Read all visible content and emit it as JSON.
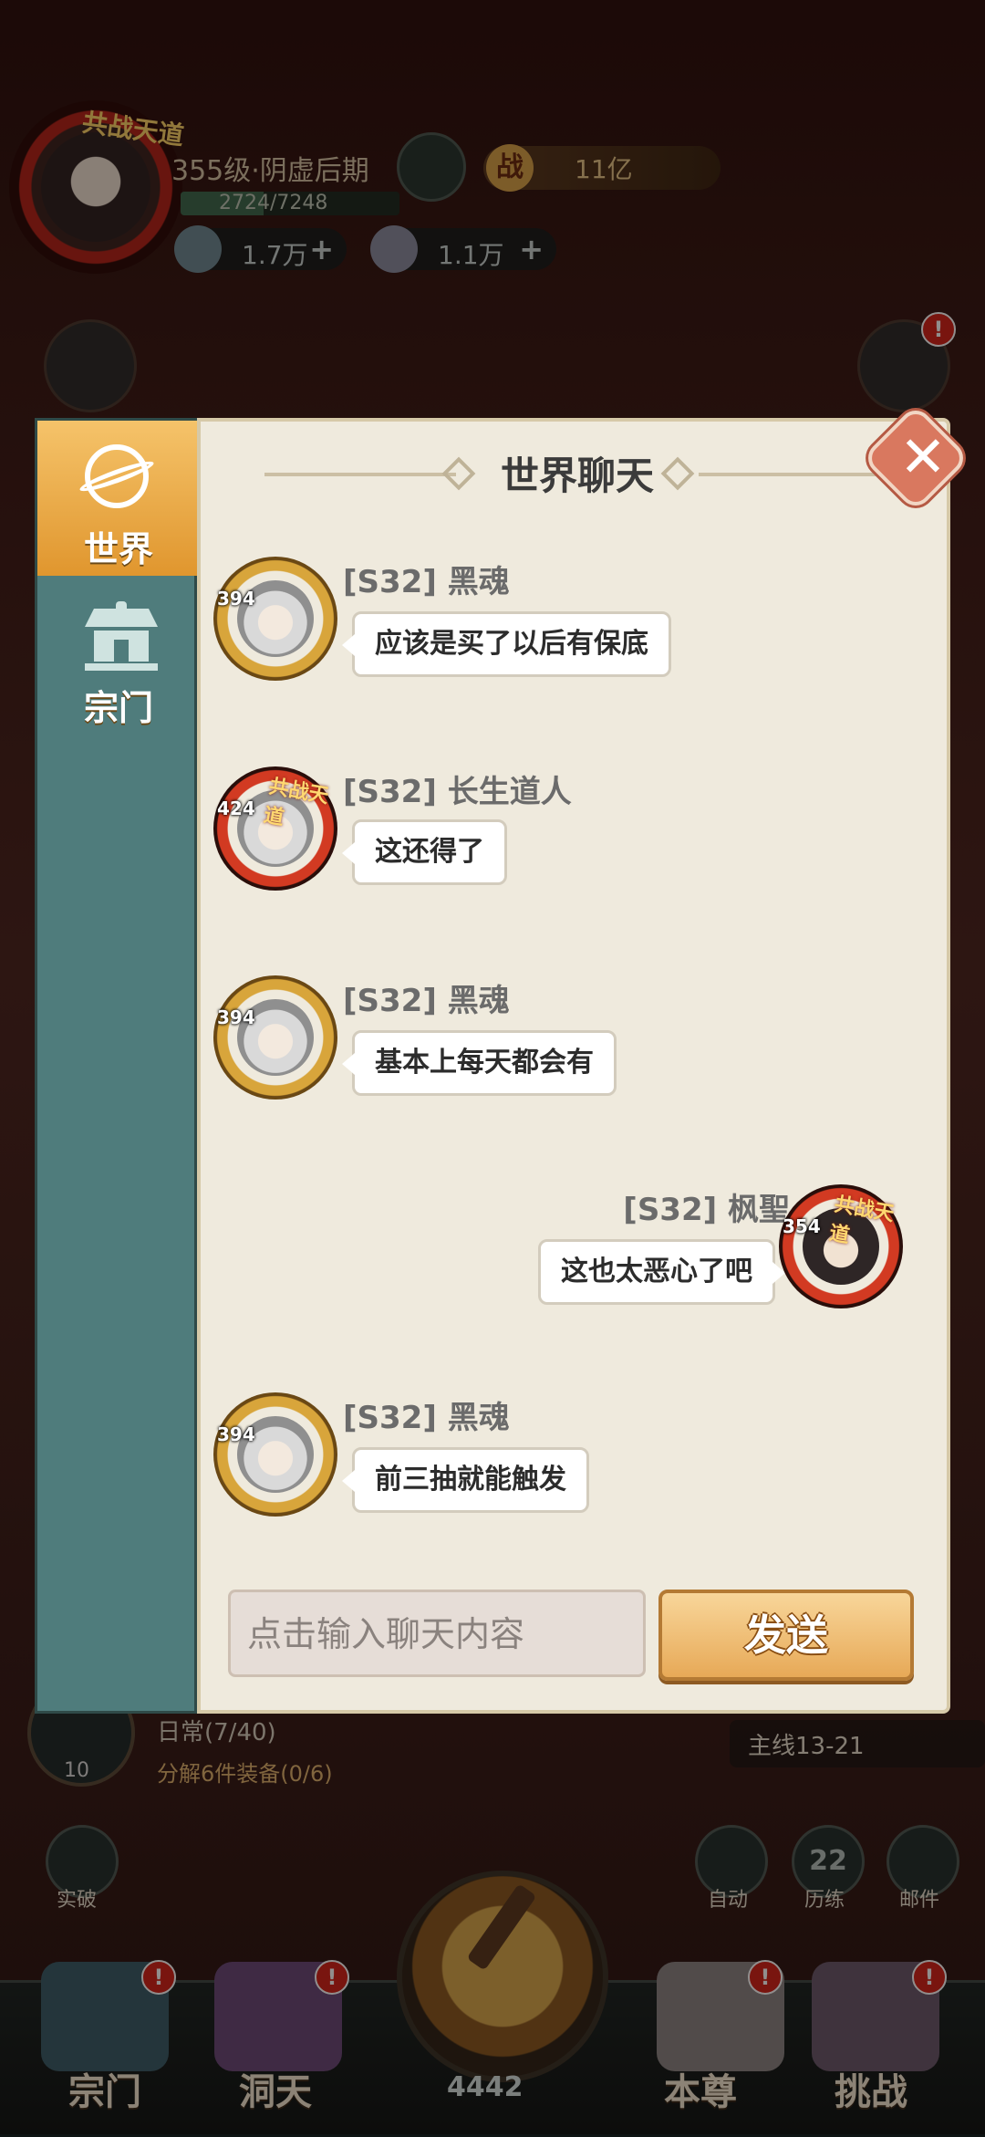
{
  "hud": {
    "level_label": "355级·阴虚后期",
    "exp_text": "2724/7248",
    "exp_fraction": 0.376,
    "avatar_level": "355",
    "avatar_tag": "共战天道",
    "power_icon": "战",
    "power_value": "11亿",
    "res1_value": "1.7万",
    "res2_value": "1.1万",
    "plus": "+"
  },
  "chat": {
    "title": "世界聊天",
    "tabs": [
      {
        "label": "世界",
        "icon": "planet-icon",
        "active": true
      },
      {
        "label": "宗门",
        "icon": "pavilion-icon",
        "active": false
      }
    ],
    "messages": [
      {
        "side": "left",
        "name": "[S32] 黑魂",
        "level": "394",
        "frame": "gold",
        "text": "应该是买了以后有保底"
      },
      {
        "side": "left",
        "name": "[S32] 长生道人",
        "level": "424",
        "frame": "fire",
        "tag": "共战天道",
        "text": "这还得了"
      },
      {
        "side": "left",
        "name": "[S32] 黑魂",
        "level": "394",
        "frame": "gold",
        "text": "基本上每天都会有"
      },
      {
        "side": "right",
        "name": "[S32] 枫聖",
        "level": "354",
        "frame": "fire",
        "tag": "共战天道",
        "text": "这也太恶心了吧"
      },
      {
        "side": "left",
        "name": "[S32] 黑魂",
        "level": "394",
        "frame": "gold",
        "text": "前三抽就能触发"
      }
    ],
    "input_placeholder": "点击输入聊天内容",
    "send_label": "发送",
    "close": "✕"
  },
  "bottom": {
    "quest_level": "10",
    "quest_line1": "日常(7/40)",
    "quest_line2": "分解6件装备(0/6)",
    "mainline": "主线13-21",
    "breakthrough": "实破",
    "auto": "自动",
    "trial_count": "22",
    "trial": "历练",
    "mail": "邮件",
    "gem_count": "4442",
    "nav": [
      "宗门",
      "洞天",
      "本尊",
      "挑战"
    ],
    "badge": "!"
  },
  "colors": {
    "tab_bg": "#4f7c7c",
    "active_tab": "#f0b04d",
    "panel_bg": "#efeadd",
    "send_button": "#e7a957",
    "close_button": "#d9785f"
  }
}
